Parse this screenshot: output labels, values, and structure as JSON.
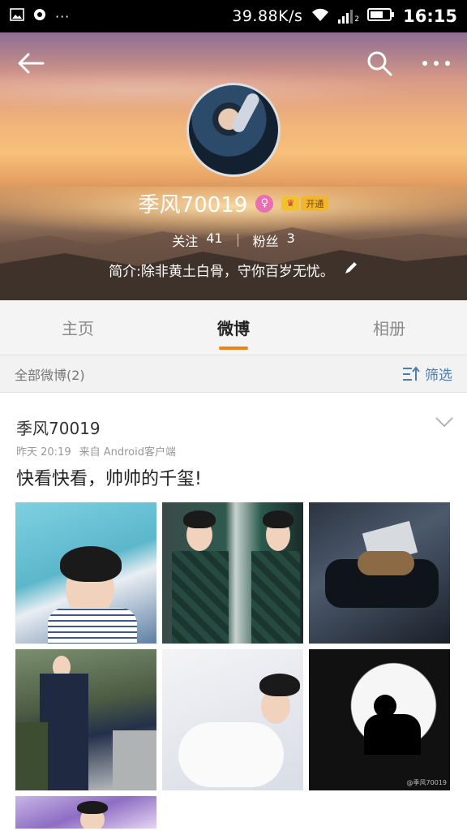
{
  "status_bar": {
    "speed": "39.88K/s",
    "sim_label": "2",
    "time": "16:15",
    "left_dots": "···"
  },
  "profile": {
    "name": "季风70019",
    "gender_symbol": "♀",
    "vip_label": "开通",
    "following_label": "关注",
    "following_count": "41",
    "followers_label": "粉丝",
    "followers_count": "3",
    "bio": "简介:除非黄土白骨，守你百岁无忧。"
  },
  "tabs": [
    {
      "label": "主页",
      "active": false
    },
    {
      "label": "微博",
      "active": true
    },
    {
      "label": "相册",
      "active": false
    }
  ],
  "filter_bar": {
    "title": "全部微博(2)",
    "filter_label": "筛选"
  },
  "post": {
    "author": "季风70019",
    "time": "昨天  20:19",
    "source": "来自 Android客户端",
    "text": "快看快看，帅帅的千玺!",
    "photo_watermark": "@季风70019"
  },
  "colors": {
    "accent": "#f08318",
    "link_blue": "#4a7fb5",
    "status_bar": "#000000"
  },
  "icons": [
    "back-arrow-icon",
    "search-icon",
    "more-icon",
    "edit-pencil-icon",
    "filter-icon",
    "chevron-down-icon",
    "wifi-icon",
    "signal-icon",
    "battery-icon",
    "image-icon",
    "sync-icon"
  ]
}
